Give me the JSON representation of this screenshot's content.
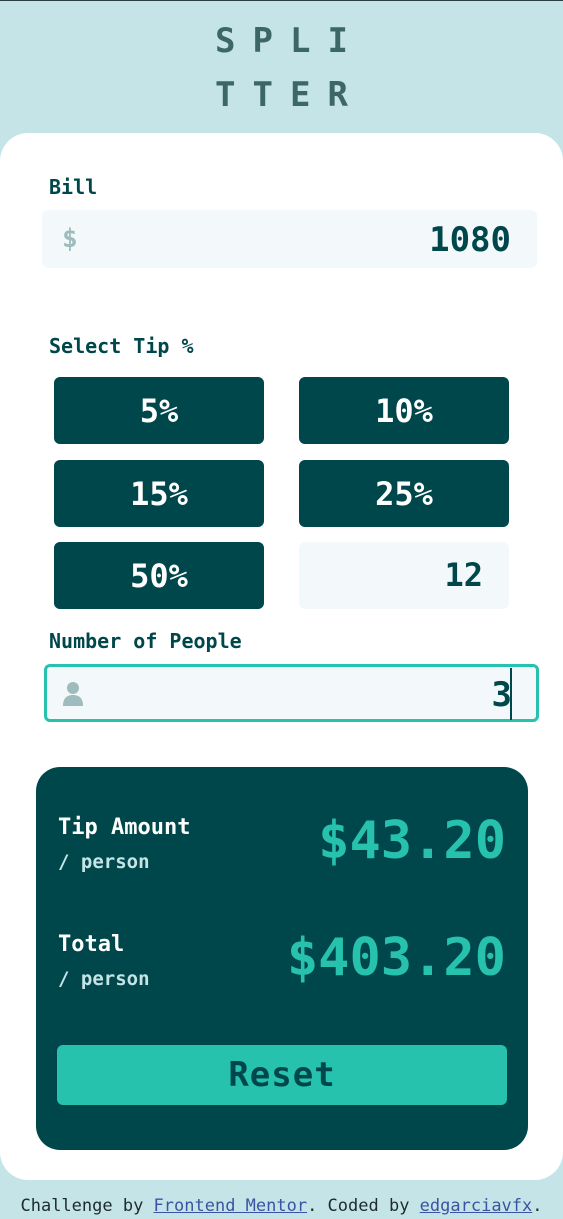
{
  "logo": {
    "line1": "SPLI",
    "line2": "TTER"
  },
  "bill": {
    "label": "Bill",
    "currency_icon": "$",
    "value": "1080"
  },
  "tip": {
    "label": "Select Tip %",
    "options": [
      "5%",
      "10%",
      "15%",
      "25%",
      "50%"
    ],
    "custom_value": "12"
  },
  "people": {
    "label": "Number of People",
    "icon": "person-icon",
    "value": "3"
  },
  "results": {
    "tip_title": "Tip Amount",
    "tip_sub": "/ person",
    "tip_value": "$43.20",
    "total_title": "Total",
    "total_sub": "/ person",
    "total_value": "$403.20",
    "reset_label": "Reset"
  },
  "footer": {
    "prefix": "Challenge by ",
    "link1": "Frontend Mentor",
    "middle": ". Coded by ",
    "link2": "edgarciavfx",
    "suffix": "."
  },
  "colors": {
    "background": "#c5e4e7",
    "dark_teal": "#00474b",
    "accent": "#26c2ad",
    "field_bg": "#f3f9fa"
  }
}
